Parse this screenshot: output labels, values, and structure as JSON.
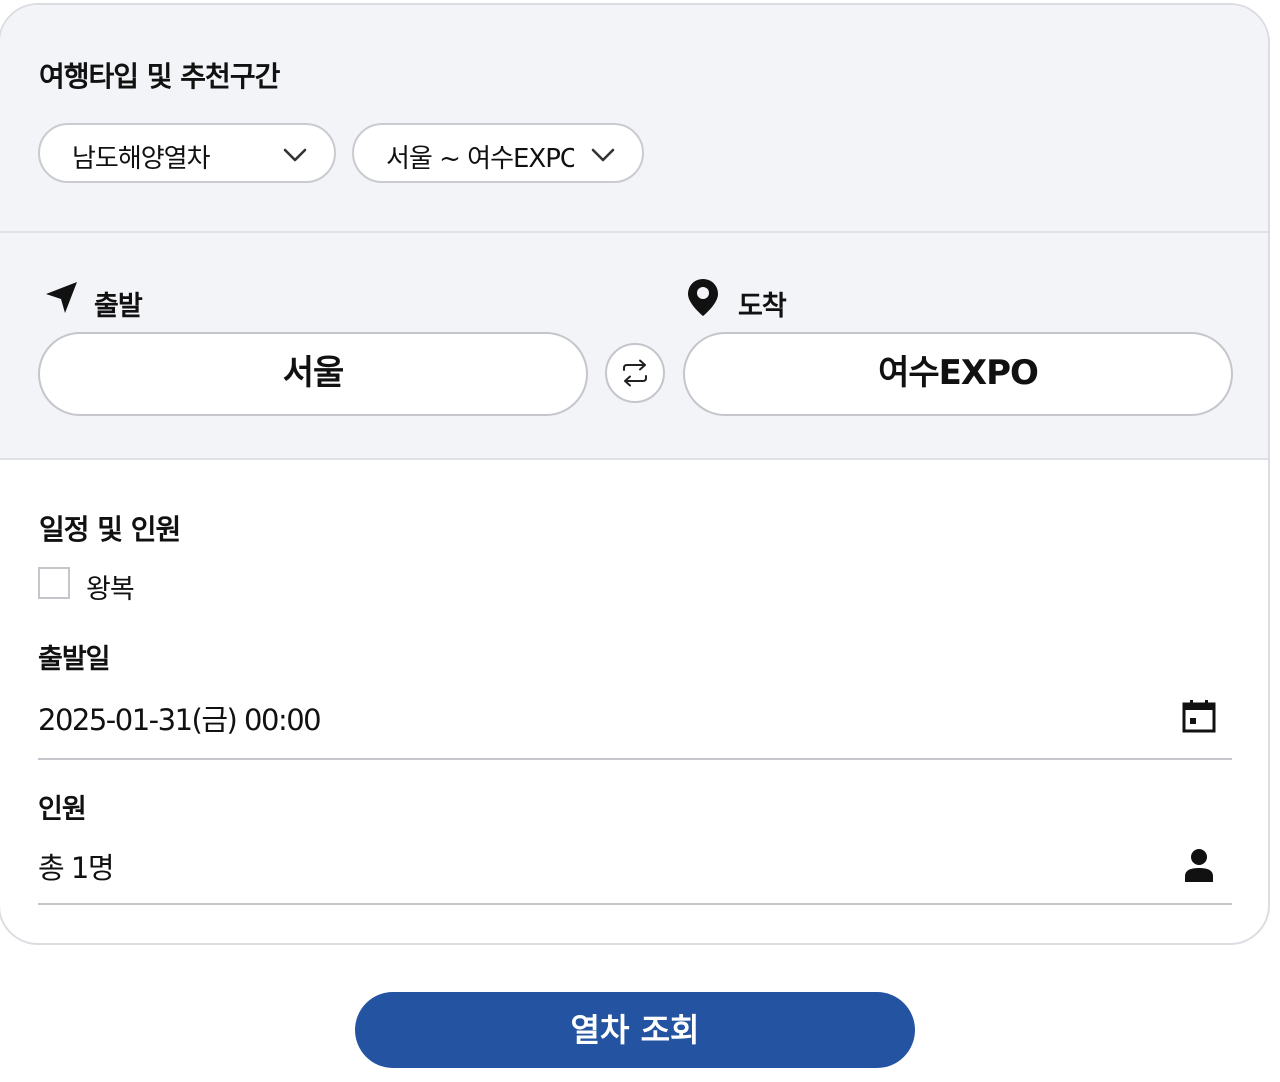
{
  "type_section": {
    "title": "여행타입 및 추천구간",
    "travel_type": "남도해양열차",
    "route": "서울 ~ 여수EXPO"
  },
  "route_section": {
    "departure_label": "출발",
    "arrival_label": "도착",
    "departure_station": "서울",
    "arrival_station": "여수EXPO"
  },
  "schedule": {
    "title": "일정 및 인원",
    "round_trip_label": "왕복",
    "round_trip_checked": false,
    "date_label": "출발일",
    "date_value": "2025-01-31(금) 00:00",
    "passengers_label": "인원",
    "passengers_value": "총 1명"
  },
  "submit_label": "열차 조회",
  "colors": {
    "accent": "#2353a1",
    "panel_bg": "#f3f4f8",
    "border": "#c4c6cb"
  },
  "icons": {
    "departure": "navigation-arrow-icon",
    "arrival": "map-pin-icon",
    "swap": "swap-arrows-icon",
    "date": "calendar-icon",
    "passengers": "person-icon",
    "select": "chevron-down-icon"
  }
}
